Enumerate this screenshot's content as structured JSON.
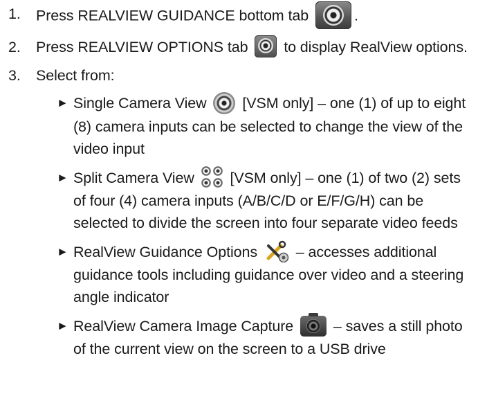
{
  "steps": [
    {
      "num": "1.",
      "before": "Press REALVIEW GUIDANCE bottom tab",
      "after": ".",
      "icon": "realview-guidance-tab-icon"
    },
    {
      "num": "2.",
      "before": "Press REALVIEW OPTIONS tab",
      "after": "to display RealView options.",
      "icon": "realview-options-tab-icon"
    },
    {
      "num": "3.",
      "before": "Select from:",
      "after": ""
    }
  ],
  "bullets": [
    {
      "arrow": "►",
      "before": "Single Camera View",
      "after": "[VSM only] – one (1) of up to eight (8) camera inputs can be selected to change the view of the video input",
      "icon": "single-camera-view-icon"
    },
    {
      "arrow": "►",
      "before": "Split Camera View",
      "after": "[VSM only] – one (1) of two (2) sets of four (4) camera inputs (A/B/C/D or E/F/G/H) can be selected to divide the screen into four separate video feeds",
      "icon": "split-camera-view-icon"
    },
    {
      "arrow": "►",
      "before": "RealView Guidance Options",
      "after": "– accesses additional guidance tools including guidance over video and a steering angle indicator",
      "icon": "tools-icon"
    },
    {
      "arrow": "►",
      "before": "RealView Camera Image Capture",
      "after": "– saves a still photo of the current view on the screen to a USB drive",
      "icon": "camera-capture-icon"
    }
  ]
}
